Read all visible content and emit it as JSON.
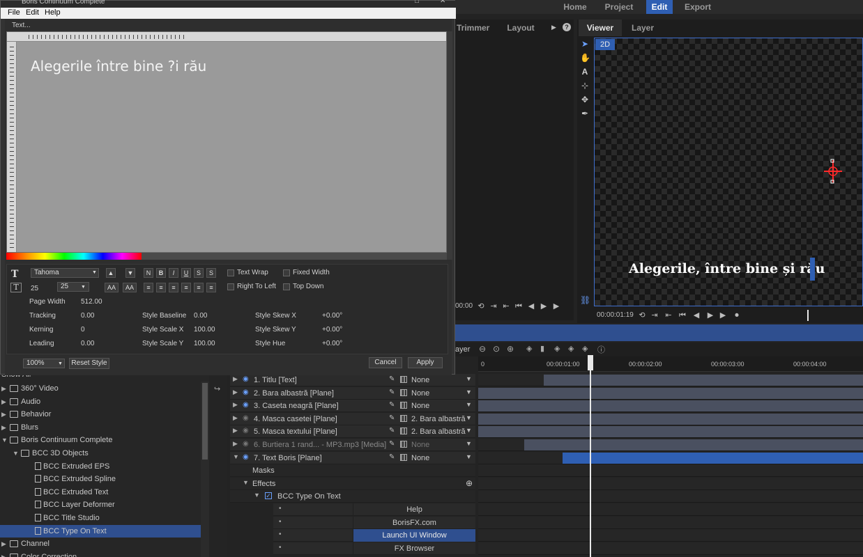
{
  "window": {
    "title": "Boris Continuum Complete"
  },
  "nav": {
    "tabs": [
      "Home",
      "Project",
      "Edit",
      "Export"
    ],
    "active": "Edit"
  },
  "left_panel": {
    "tabs": [
      "Trimmer",
      "Layout"
    ]
  },
  "viewer": {
    "tabs": [
      "Viewer",
      "Layer"
    ],
    "badge": "2D",
    "title_text": "Alegerile, între bine și rău",
    "timecode": "00:00:01:19",
    "trimmer_timecode": "00:00"
  },
  "dialog": {
    "menu": [
      "File",
      "Edit",
      "Help"
    ],
    "text_menu": "Text...",
    "editor_text": "Alegerile între bine ?i rău",
    "font": "Tahoma",
    "size_value": "25",
    "size_select": "25",
    "style_buttons": [
      "N",
      "B",
      "I",
      "U",
      "S",
      "S"
    ],
    "checkboxes": [
      {
        "label": "Text Wrap",
        "checked": false
      },
      {
        "label": "Fixed Width",
        "checked": false
      },
      {
        "label": "Right To Left",
        "checked": false
      },
      {
        "label": "Top Down",
        "checked": false
      }
    ],
    "page_width_label": "Page Width",
    "page_width": "512.00",
    "params": [
      {
        "label": "Tracking",
        "value": "0.00"
      },
      {
        "label": "Kerning",
        "value": "0"
      },
      {
        "label": "Leading",
        "value": "0.00"
      }
    ],
    "style_params": [
      {
        "label": "Style Baseline",
        "value": "0.00"
      },
      {
        "label": "Style Scale X",
        "value": "100.00"
      },
      {
        "label": "Style Scale Y",
        "value": "100.00"
      }
    ],
    "skew_params": [
      {
        "label": "Style Skew X",
        "value": "+0.00°"
      },
      {
        "label": "Style Skew Y",
        "value": "+0.00°"
      },
      {
        "label": "Style Hue",
        "value": "+0.00°"
      }
    ],
    "zoom": "100%",
    "reset_style": "Reset Style",
    "cancel": "Cancel",
    "apply": "Apply"
  },
  "timeline": {
    "ruler": [
      "0",
      "00:00:01:00",
      "00:00:02:00",
      "00:00:03:00",
      "00:00:04:00"
    ],
    "layer_label": "ayer",
    "layers": [
      {
        "name": "1. Titlu [Text]",
        "mode": "None",
        "visible": true,
        "clip_start": 0.17,
        "color": "gray"
      },
      {
        "name": "2. Bara albastră [Plane]",
        "mode": "None",
        "visible": true,
        "clip_start": 0.0,
        "color": "gray"
      },
      {
        "name": "3. Caseta neagră [Plane]",
        "mode": "None",
        "visible": true,
        "clip_start": 0.0,
        "color": "gray"
      },
      {
        "name": "4. Masca casetei [Plane]",
        "mode": "2. Bara albastră",
        "visible": false,
        "clip_start": 0.0,
        "color": "gray"
      },
      {
        "name": "5. Masca textului [Plane]",
        "mode": "2. Bara albastră",
        "visible": false,
        "clip_start": 0.0,
        "color": "gray"
      },
      {
        "name": "6. Burtiera 1 rand... - MP3.mp3 [Media]",
        "mode": "None",
        "visible": false,
        "clip_start": 0.12,
        "color": "gray"
      },
      {
        "name": "7. Text Boris [Plane]",
        "mode": "None",
        "visible": true,
        "clip_start": 0.22,
        "color": "blue"
      }
    ],
    "masks_label": "Masks",
    "effects_label": "Effects",
    "effect_name": "BCC Type On Text",
    "effect_buttons": [
      "Help",
      "BorisFX.com",
      "Launch UI Window",
      "FX Browser"
    ],
    "selected_button": "Launch UI Window"
  },
  "effects_tree": {
    "show_all": "Show All",
    "items": [
      {
        "label": "360° Video",
        "level": 0,
        "type": "folder",
        "expanded": false
      },
      {
        "label": "Audio",
        "level": 0,
        "type": "folder",
        "expanded": false
      },
      {
        "label": "Behavior",
        "level": 0,
        "type": "folder",
        "expanded": false
      },
      {
        "label": "Blurs",
        "level": 0,
        "type": "folder",
        "expanded": false
      },
      {
        "label": "Boris Continuum Complete",
        "level": 0,
        "type": "folder",
        "expanded": true
      },
      {
        "label": "BCC 3D Objects",
        "level": 1,
        "type": "folder",
        "expanded": true
      },
      {
        "label": "BCC Extruded EPS",
        "level": 2,
        "type": "file"
      },
      {
        "label": "BCC Extruded Spline",
        "level": 2,
        "type": "file"
      },
      {
        "label": "BCC Extruded Text",
        "level": 2,
        "type": "file"
      },
      {
        "label": "BCC Layer Deformer",
        "level": 2,
        "type": "file"
      },
      {
        "label": "BCC Title Studio",
        "level": 2,
        "type": "file"
      },
      {
        "label": "BCC Type On Text",
        "level": 2,
        "type": "file",
        "selected": true
      },
      {
        "label": "Channel",
        "level": 0,
        "type": "folder",
        "expanded": false
      },
      {
        "label": "Color Correction",
        "level": 0,
        "type": "folder",
        "expanded": false
      }
    ]
  },
  "colors": {
    "accent": "#2f5fb3",
    "panel": "#232323",
    "selection": "#2f4f8f"
  }
}
